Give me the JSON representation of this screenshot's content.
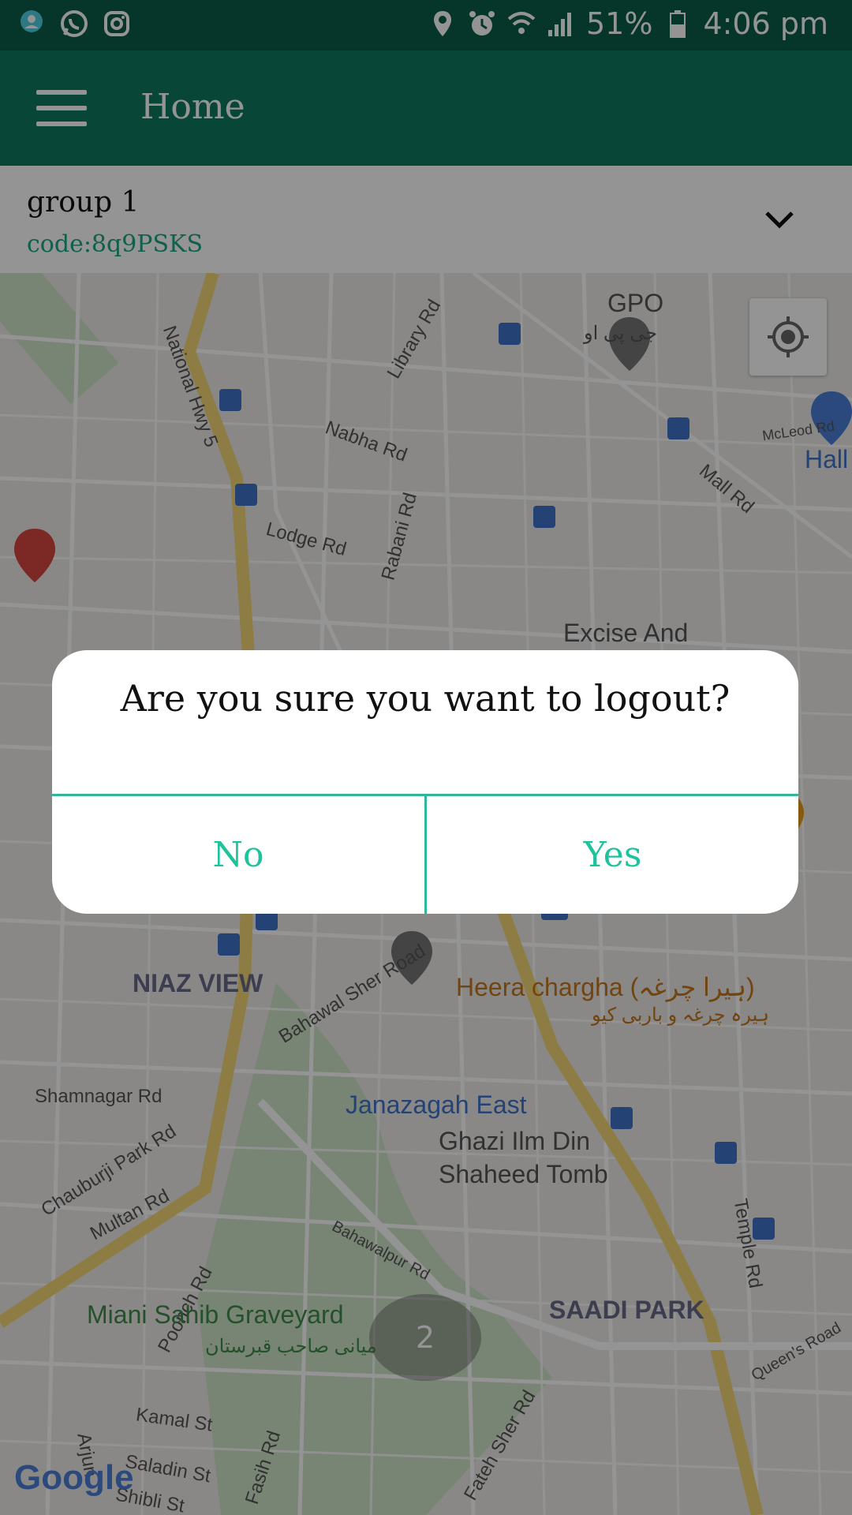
{
  "status_bar": {
    "battery": "51%",
    "time": "4:06 pm",
    "left_icons": [
      "app-location-icon",
      "whatsapp-icon",
      "instagram-icon"
    ],
    "right_icons": [
      "location-icon",
      "alarm-icon",
      "wifi-icon",
      "signal-icon",
      "battery-icon"
    ]
  },
  "app_bar": {
    "title": "Home",
    "menu_icon": "hamburger-menu-icon"
  },
  "group": {
    "name": "group 1",
    "code": "code:8q9PSKS"
  },
  "map": {
    "labels": {
      "gpo": "GPO",
      "gpo_urdu": "جی پی او",
      "library_rd": "Library Rd",
      "national_hwy": "National Hwy 5",
      "nabha_rd": "Nabha Rd",
      "mcleod_rd": "McLeod Rd",
      "hall": "Hall",
      "mall_rd": "Mall Rd",
      "lodge_rd": "Lodge Rd",
      "rabani_rd": "Rabani Rd",
      "excise": "Excise And",
      "niaz_view": "NIAZ VIEW",
      "bahawal_sher": "Bahawal Sher Road",
      "heera": "Heera chargha (ہیرا چرغہ)",
      "heera_urdu": "ہیرہ چرغہ و باربی کیو",
      "shamnagar": "Shamnagar Rd",
      "janazagah": "Janazagah East",
      "ghazi_1": "Ghazi Ilm Din",
      "ghazi_2": "Shaheed Tomb",
      "chauburji": "Chauburji Park Rd",
      "multan": "Multan Rd",
      "bahawalpur": "Bahawalpur Rd",
      "temple": "Temple Rd",
      "poonch": "Poonch Rd",
      "miani": "Miani Sahib Graveyard",
      "miani_urdu": "میانی صاحب قبرستان",
      "saadi": "SAADI PARK",
      "queens": "Queen's Road",
      "kamal": "Kamal St",
      "saladin": "Saladin St",
      "shibli": "Shibli St",
      "fasih": "Fasih Rd",
      "fateh": "Fateh Sher Rd",
      "arjun": "Arjun"
    },
    "cluster_count": "2",
    "google": "Google",
    "locate_icon": "my-location-icon"
  },
  "dialog": {
    "message": "Are you sure you want to logout?",
    "no_label": "No",
    "yes_label": "Yes"
  },
  "colors": {
    "status_bar": "#0c5c49",
    "app_bar": "#0f7a60",
    "accent": "#1ec29b"
  }
}
